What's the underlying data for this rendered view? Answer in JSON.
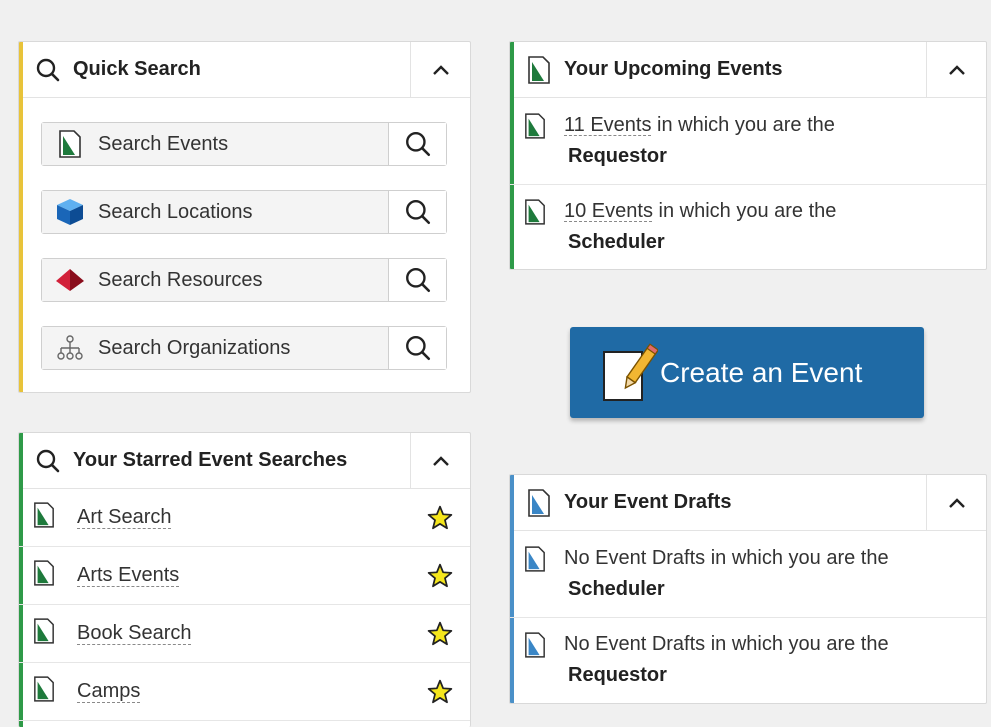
{
  "colors": {
    "quick_search_accent": "#e8c33a",
    "green_accent": "#2e9a48",
    "blue_accent": "#4a90c8",
    "create_button_bg": "#1f6aa5"
  },
  "quick_search": {
    "title": "Quick Search",
    "icon": "search-icon",
    "items": [
      {
        "label": "Search Events",
        "icon": "event-doc-icon"
      },
      {
        "label": "Search Locations",
        "icon": "cube-icon"
      },
      {
        "label": "Search Resources",
        "icon": "pyramid-icon"
      },
      {
        "label": "Search Organizations",
        "icon": "org-tree-icon"
      }
    ]
  },
  "upcoming_events": {
    "title": "Your Upcoming Events",
    "icon": "event-doc-icon",
    "rows": [
      {
        "count_link": "11 Events",
        "text": " in which you are the",
        "role": "Requestor"
      },
      {
        "count_link": "10 Events",
        "text": " in which you are the",
        "role": "Scheduler"
      }
    ]
  },
  "create_event": {
    "label": "Create an Event",
    "icon": "notepad-pencil-icon"
  },
  "starred_searches": {
    "title": "Your Starred Event Searches",
    "icon": "search-icon",
    "items": [
      {
        "label": "Art Search"
      },
      {
        "label": "Arts Events"
      },
      {
        "label": "Book Search"
      },
      {
        "label": "Camps"
      }
    ]
  },
  "event_drafts": {
    "title": "Your Event Drafts",
    "icon": "draft-doc-icon",
    "rows": [
      {
        "text": "No Event Drafts in which you are the",
        "role": "Scheduler"
      },
      {
        "text": "No Event Drafts in which you are the",
        "role": "Requestor"
      }
    ]
  }
}
